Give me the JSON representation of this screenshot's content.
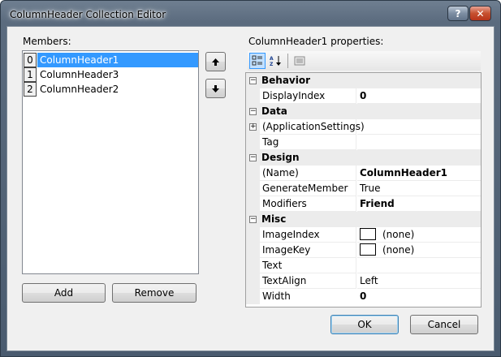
{
  "window": {
    "title": "ColumnHeader Collection Editor",
    "help_glyph": "?",
    "close_glyph": "✕"
  },
  "members": {
    "label": "Members:",
    "items": [
      {
        "index": "0",
        "name": "ColumnHeader1",
        "selected": true
      },
      {
        "index": "1",
        "name": "ColumnHeader3",
        "selected": false
      },
      {
        "index": "2",
        "name": "ColumnHeader2",
        "selected": false
      }
    ],
    "add_label": "Add",
    "remove_label": "Remove",
    "move_up_icon": "arrow-up-icon",
    "move_down_icon": "arrow-down-icon"
  },
  "properties": {
    "label": "ColumnHeader1 properties:",
    "toolbar": [
      "categorized-icon",
      "alphabetical-icon",
      "property-pages-icon"
    ],
    "categories": [
      {
        "name": "Behavior",
        "rows": [
          {
            "name": "DisplayIndex",
            "value": "0",
            "bold": true
          }
        ]
      },
      {
        "name": "Data",
        "rows": [
          {
            "name": "(ApplicationSettings)",
            "value": "",
            "expander": "+"
          },
          {
            "name": "Tag",
            "value": ""
          }
        ]
      },
      {
        "name": "Design",
        "rows": [
          {
            "name": "(Name)",
            "value": "ColumnHeader1",
            "bold": true
          },
          {
            "name": "GenerateMember",
            "value": "True"
          },
          {
            "name": "Modifiers",
            "value": "Friend",
            "bold": true
          }
        ]
      },
      {
        "name": "Misc",
        "rows": [
          {
            "name": "ImageIndex",
            "value": "(none)",
            "swatch": true
          },
          {
            "name": "ImageKey",
            "value": "(none)",
            "swatch": true
          },
          {
            "name": "Text",
            "value": ""
          },
          {
            "name": "TextAlign",
            "value": "Left"
          },
          {
            "name": "Width",
            "value": "0",
            "bold": true
          }
        ]
      }
    ],
    "collapse_glyph": "−"
  },
  "footer": {
    "ok_label": "OK",
    "cancel_label": "Cancel"
  }
}
